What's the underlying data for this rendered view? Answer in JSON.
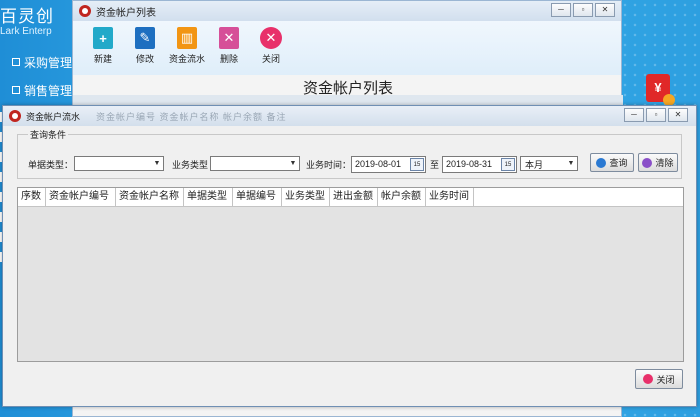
{
  "desktop": {
    "logo": "百灵创",
    "logo_sub": "Lark Enterp",
    "menu": [
      {
        "label": "采购管理"
      },
      {
        "label": "销售管理"
      }
    ],
    "envelope_symbol": "¥"
  },
  "back_window": {
    "title": "资金帐户列表",
    "controls": {
      "minimize": "─",
      "restore": "▫",
      "close": "✕"
    },
    "toolbar": [
      {
        "label": "新建",
        "icon": "new-icon",
        "glyph": "+"
      },
      {
        "label": "修改",
        "icon": "edit-icon",
        "glyph": "✎"
      },
      {
        "label": "资金流水",
        "icon": "bank-icon",
        "glyph": "▥"
      },
      {
        "label": "删除",
        "icon": "delete-icon",
        "glyph": "✕"
      },
      {
        "label": "关闭",
        "icon": "close-icon",
        "glyph": "✕"
      }
    ],
    "page_title": "资金帐户列表"
  },
  "front_window": {
    "title": "资金帐户流水",
    "title_ghost": "资金帐户编号  资金帐户名称  帐户余额  备注",
    "controls": {
      "minimize": "─",
      "restore": "▫",
      "close": "✕"
    },
    "filter": {
      "legend": "查询条件",
      "doc_type_label": "单据类型：",
      "doc_type_value": "",
      "biz_type_label": "业务类型",
      "biz_type_value": "",
      "biz_time_label": "业务时间：",
      "date_from": "2019-08-01",
      "date_to_label": "至",
      "date_to": "2019-08-31",
      "calendar_day": "15",
      "period": "本月",
      "query_button": "查询",
      "clear_button": "清除"
    },
    "grid": {
      "columns": [
        "序数",
        "资金帐户编号",
        "资金帐户名称",
        "单据类型",
        "单据编号",
        "业务类型",
        "进出金额",
        "帐户余额",
        "业务时间"
      ]
    },
    "close_button": "关闭"
  }
}
